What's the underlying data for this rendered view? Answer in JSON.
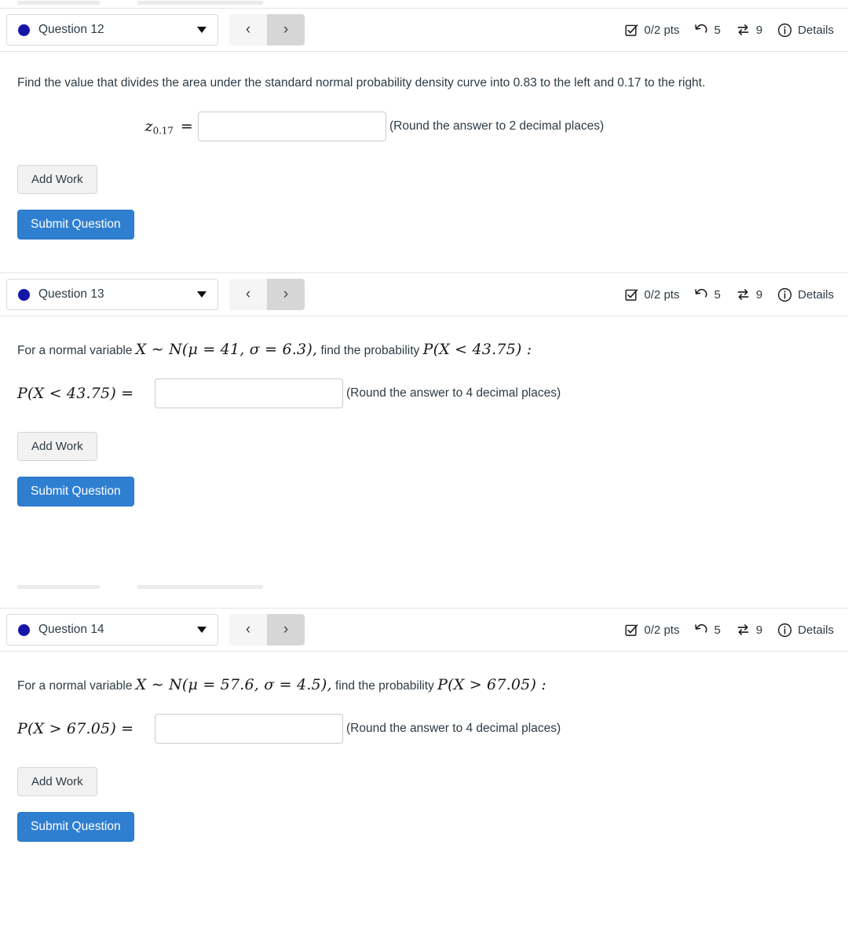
{
  "questions": [
    {
      "dot_color": "#1515a8",
      "select_label": "Question 12",
      "prev_label": "‹",
      "next_label": "›",
      "status": {
        "points": "0/2 pts",
        "attempts": "5",
        "exchanges": "9",
        "details_label": "Details",
        "points_icon": "checkbox-check-icon",
        "attempts_icon": "undo-arrow-icon",
        "exchanges_icon": "swap-arrows-icon",
        "details_icon": "info-circle-icon"
      },
      "prompt": "Find the value that divides the area under the standard normal probability density curve into 0.83 to the left and 0.17 to the right.",
      "answer": {
        "label_main": "z",
        "label_sub": "0.17",
        "label_eq": "=",
        "value": "",
        "placeholder": "",
        "hint": "(Round the answer to 2 decimal places)",
        "input_width": 240,
        "label_width": 230
      },
      "add_work_label": "Add Work",
      "submit_label": "Submit Question"
    },
    {
      "dot_color": "#1515a8",
      "select_label": "Question 13",
      "prev_label": "‹",
      "next_label": "›",
      "status": {
        "points": "0/2 pts",
        "attempts": "5",
        "exchanges": "9",
        "details_label": "Details",
        "points_icon": "checkbox-check-icon",
        "attempts_icon": "undo-arrow-icon",
        "exchanges_icon": "swap-arrows-icon",
        "details_icon": "info-circle-icon"
      },
      "prompt_prefix": "For a normal variable ",
      "prompt_math": "X ∼ N(μ = 41, σ = 6.3),",
      "prompt_middle": " find the probability ",
      "prompt_math2": "P(X < 43.75) :",
      "mu": "41",
      "sigma": "6.3",
      "probability": "P(X < 43.75)",
      "answer": {
        "label_expr": "P(X < 43.75)  =",
        "value": "",
        "placeholder": "",
        "hint": "(Round the answer to 4 decimal places)",
        "input_width": 240
      },
      "add_work_label": "Add Work",
      "submit_label": "Submit Question"
    },
    {
      "dot_color": "#1515a8",
      "select_label": "Question 14",
      "prev_label": "‹",
      "next_label": "›",
      "status": {
        "points": "0/2 pts",
        "attempts": "5",
        "exchanges": "9",
        "details_label": "Details",
        "points_icon": "checkbox-check-icon",
        "attempts_icon": "undo-arrow-icon",
        "exchanges_icon": "swap-arrows-icon",
        "details_icon": "info-circle-icon"
      },
      "prompt_prefix": "For a normal variable ",
      "prompt_math": "X ∼ N(μ = 57.6, σ = 4.5),",
      "prompt_middle": " find the probability ",
      "prompt_math2": "P(X > 67.05) :",
      "mu": "57.6",
      "sigma": "4.5",
      "probability": "P(X > 67.05)",
      "answer": {
        "label_expr": "P(X > 67.05)  =",
        "value": "",
        "placeholder": "",
        "hint": "(Round the answer to 4 decimal places)",
        "input_width": 240
      },
      "add_work_label": "Add Work",
      "submit_label": "Submit Question"
    }
  ]
}
